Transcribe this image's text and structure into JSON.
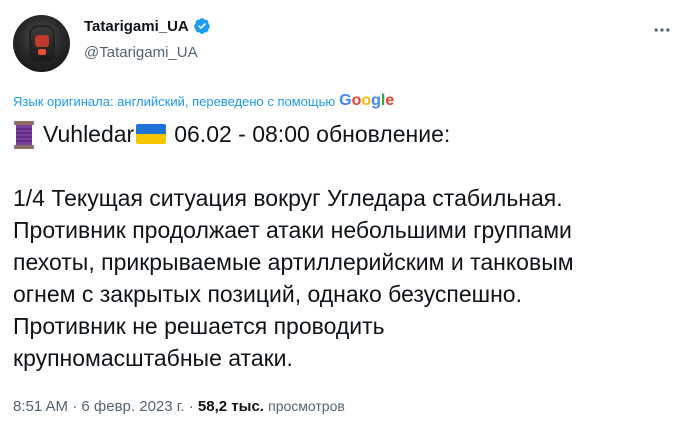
{
  "author": {
    "display_name": "Tatarigami_UA",
    "handle": "@Tatarigami_UA"
  },
  "translation_note": "Язык оригинала: английский, переведено с помощью",
  "google_logo_letters": [
    "G",
    "o",
    "o",
    "g",
    "l",
    "e"
  ],
  "tweet": {
    "headline_place": "Vuhledar",
    "headline_rest": "06.02 - 08:00 обновление:",
    "body_lines": [
      "1/4 Текущая ситуация вокруг Угледара стабильная.",
      "Противник продолжает атаки небольшими группами",
      "пехоты, прикрываемые артиллерийским и танковым",
      "огнем с закрытых позиций, однако безуспешно.",
      "Противник не решается проводить",
      "крупномасштабные атаки."
    ]
  },
  "meta": {
    "time": "8:51 AM",
    "separator": "·",
    "date": "6 февр. 2023 г.",
    "views_count": "58,2 тыс.",
    "views_label": "просмотров"
  },
  "icons": {
    "verified": "verified-badge-icon",
    "more": "more-options-icon",
    "spool": "thread-spool-icon",
    "flag": "ukraine-flag-icon"
  },
  "colors": {
    "link_blue": "#1d9bf0",
    "secondary_text": "#536471",
    "primary_text": "#0f1419"
  }
}
